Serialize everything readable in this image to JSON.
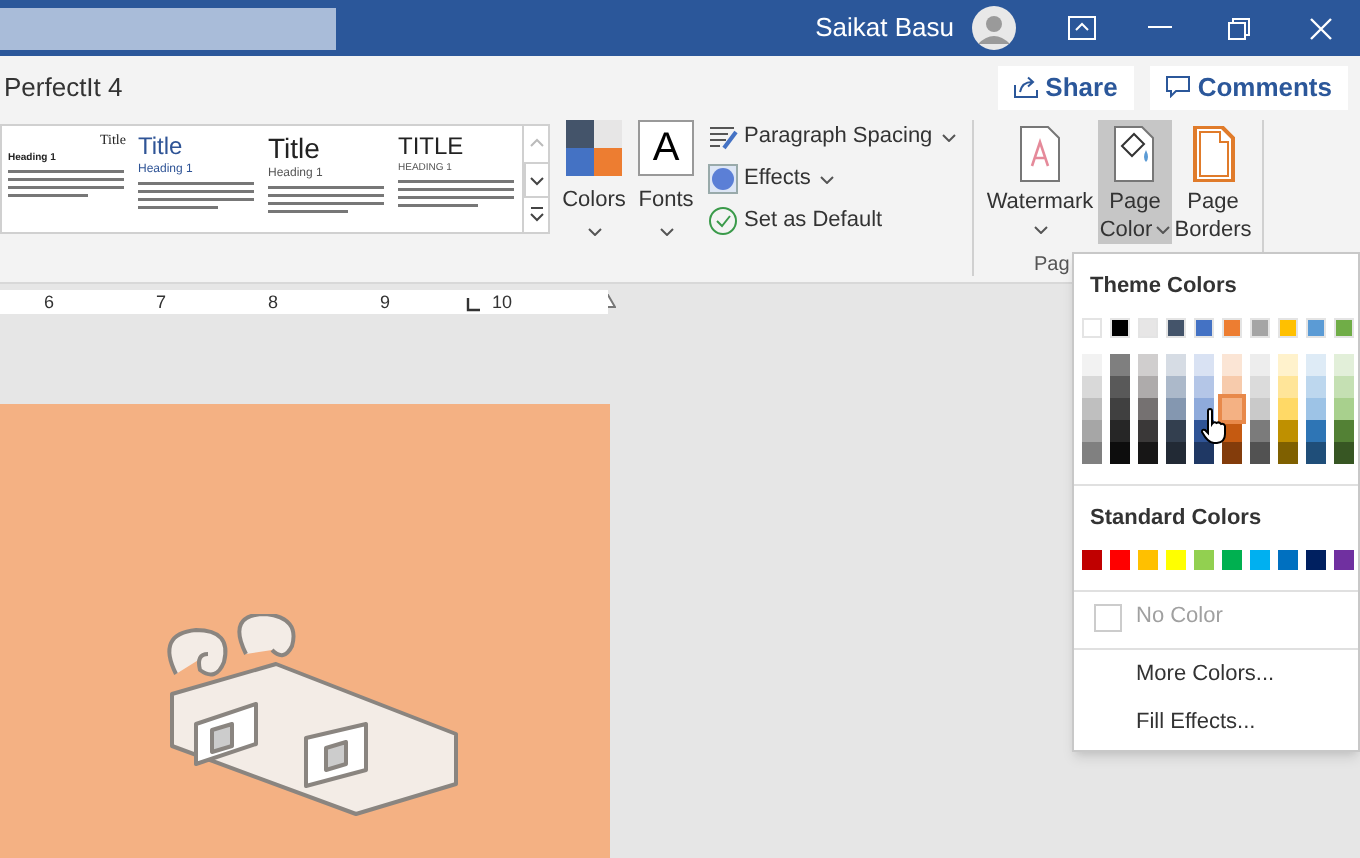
{
  "title_bar": {
    "user_name": "Saikat Basu"
  },
  "document_title": "PerfectIt 4",
  "header_buttons": [
    {
      "label": "Share",
      "kind": "share"
    },
    {
      "label": "Comments",
      "kind": "comments"
    }
  ],
  "style_gallery": [
    {
      "kind": "basic",
      "title": "Title",
      "heading": "Heading 1"
    },
    {
      "kind": "blue",
      "title": "Title",
      "heading": "Heading 1"
    },
    {
      "kind": "large",
      "title": "Title",
      "heading": "Heading 1"
    },
    {
      "kind": "caps",
      "title": "TITLE",
      "heading": "HEADING 1"
    }
  ],
  "design_buttons": [
    {
      "label": "Colors",
      "kind": "colors"
    },
    {
      "label": "Fonts",
      "kind": "fonts",
      "glyph": "A"
    }
  ],
  "format_options": [
    {
      "label": "Paragraph Spacing",
      "kind": "spacing",
      "dropdown": true
    },
    {
      "label": "Effects",
      "kind": "effects",
      "dropdown": true
    },
    {
      "label": "Set as Default",
      "kind": "default",
      "dropdown": false
    }
  ],
  "page_background": {
    "group_label": "Pag",
    "buttons": [
      {
        "lines": [
          "Watermark"
        ],
        "kind": "watermark",
        "selected": false,
        "dropdown": true
      },
      {
        "lines": [
          "Page",
          "Color"
        ],
        "kind": "page_color",
        "selected": true,
        "dropdown": true
      },
      {
        "lines": [
          "Page",
          "Borders"
        ],
        "kind": "page_borders",
        "selected": false,
        "dropdown": false
      }
    ]
  },
  "ruler": {
    "numbers": [
      "6",
      "7",
      "8",
      "9",
      "10"
    ]
  },
  "page_color_menu": {
    "theme_heading": "Theme Colors",
    "theme_colors": [
      {
        "color": "#ffffff",
        "selected": false,
        "shades": [
          {
            "color": "#f2f2f2",
            "selected": false
          },
          {
            "color": "#d9d9d9",
            "selected": false
          },
          {
            "color": "#bfbfbf",
            "selected": false
          },
          {
            "color": "#a6a6a6",
            "selected": false
          },
          {
            "color": "#808080",
            "selected": false
          }
        ]
      },
      {
        "color": "#000000",
        "selected": false,
        "shades": [
          {
            "color": "#7f7f7f",
            "selected": false
          },
          {
            "color": "#595959",
            "selected": false
          },
          {
            "color": "#404040",
            "selected": false
          },
          {
            "color": "#262626",
            "selected": false
          },
          {
            "color": "#0d0d0d",
            "selected": false
          }
        ]
      },
      {
        "color": "#e7e6e6",
        "selected": false,
        "shades": [
          {
            "color": "#d0cece",
            "selected": false
          },
          {
            "color": "#aeabab",
            "selected": false
          },
          {
            "color": "#757171",
            "selected": false
          },
          {
            "color": "#3a3838",
            "selected": false
          },
          {
            "color": "#171616",
            "selected": false
          }
        ]
      },
      {
        "color": "#44546a",
        "selected": false,
        "shades": [
          {
            "color": "#d6dce4",
            "selected": false
          },
          {
            "color": "#acb9ca",
            "selected": false
          },
          {
            "color": "#8497b0",
            "selected": false
          },
          {
            "color": "#333f4f",
            "selected": false
          },
          {
            "color": "#222a35",
            "selected": false
          }
        ]
      },
      {
        "color": "#4472c4",
        "selected": false,
        "shades": [
          {
            "color": "#d9e2f3",
            "selected": false
          },
          {
            "color": "#b4c6e7",
            "selected": false
          },
          {
            "color": "#8eaadb",
            "selected": false
          },
          {
            "color": "#2f5496",
            "selected": false
          },
          {
            "color": "#1f3864",
            "selected": false
          }
        ]
      },
      {
        "color": "#ed7d31",
        "selected": false,
        "shades": [
          {
            "color": "#fbe5d5",
            "selected": false
          },
          {
            "color": "#f7cbac",
            "selected": false
          },
          {
            "color": "#f4b183",
            "selected": true
          },
          {
            "color": "#c55a11",
            "selected": false
          },
          {
            "color": "#833c0b",
            "selected": false
          }
        ]
      },
      {
        "color": "#a5a5a5",
        "selected": false,
        "shades": [
          {
            "color": "#ededed",
            "selected": false
          },
          {
            "color": "#dbdbdb",
            "selected": false
          },
          {
            "color": "#c9c9c9",
            "selected": false
          },
          {
            "color": "#7b7b7b",
            "selected": false
          },
          {
            "color": "#525252",
            "selected": false
          }
        ]
      },
      {
        "color": "#ffc000",
        "selected": false,
        "shades": [
          {
            "color": "#fff2cc",
            "selected": false
          },
          {
            "color": "#ffe599",
            "selected": false
          },
          {
            "color": "#ffd966",
            "selected": false
          },
          {
            "color": "#bf9000",
            "selected": false
          },
          {
            "color": "#7f6000",
            "selected": false
          }
        ]
      },
      {
        "color": "#5b9bd5",
        "selected": false,
        "shades": [
          {
            "color": "#deebf6",
            "selected": false
          },
          {
            "color": "#bdd7ee",
            "selected": false
          },
          {
            "color": "#9dc3e6",
            "selected": false
          },
          {
            "color": "#2e75b5",
            "selected": false
          },
          {
            "color": "#1f4e79",
            "selected": false
          }
        ]
      },
      {
        "color": "#70ad47",
        "selected": false,
        "shades": [
          {
            "color": "#e2efd9",
            "selected": false
          },
          {
            "color": "#c5e0b3",
            "selected": false
          },
          {
            "color": "#a8d08d",
            "selected": false
          },
          {
            "color": "#538135",
            "selected": false
          },
          {
            "color": "#375623",
            "selected": false
          }
        ]
      }
    ],
    "standard_heading": "Standard Colors",
    "standard_colors": [
      {
        "color": "#c00000",
        "selected": false
      },
      {
        "color": "#ff0000",
        "selected": false
      },
      {
        "color": "#ffc000",
        "selected": false
      },
      {
        "color": "#ffff00",
        "selected": false
      },
      {
        "color": "#92d050",
        "selected": false
      },
      {
        "color": "#00b050",
        "selected": false
      },
      {
        "color": "#00b0f0",
        "selected": false
      },
      {
        "color": "#0070c0",
        "selected": false
      },
      {
        "color": "#002060",
        "selected": false
      },
      {
        "color": "#7030a0",
        "selected": false
      }
    ],
    "items": [
      {
        "label": "No Color",
        "kind": "none",
        "disabled": true
      },
      {
        "label": "More Colors...",
        "kind": "more",
        "disabled": false
      },
      {
        "label": "Fill Effects...",
        "kind": "fill",
        "disabled": false
      }
    ]
  },
  "page": {
    "color": "#f4b183"
  }
}
